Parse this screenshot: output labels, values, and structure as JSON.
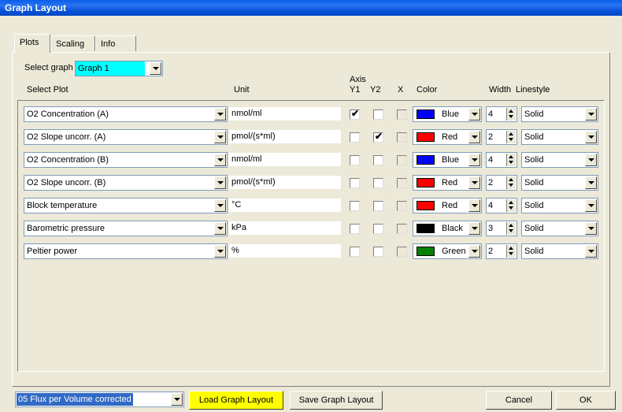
{
  "window": {
    "title": "Graph Layout"
  },
  "tabs": [
    {
      "label": "Plots"
    },
    {
      "label": "Scaling"
    },
    {
      "label": "Info"
    }
  ],
  "select_graph": {
    "label": "Select graph",
    "value": "Graph 1",
    "highlight": "#00ffff"
  },
  "headers": {
    "select_plot": "Select Plot",
    "unit": "Unit",
    "axis": "Axis",
    "y1": "Y1",
    "y2": "Y2",
    "x": "X",
    "color": "Color",
    "width": "Width",
    "linestyle": "Linestyle"
  },
  "rows": [
    {
      "plot": "O2 Concentration (A)",
      "unit": "nmol/ml",
      "y1": true,
      "y2": false,
      "x": false,
      "color_name": "Blue",
      "color_hex": "#0000ff",
      "width": "4",
      "linestyle": "Solid"
    },
    {
      "plot": "O2 Slope uncorr. (A)",
      "unit": "pmol/(s*ml)",
      "y1": false,
      "y2": true,
      "x": false,
      "color_name": "Red",
      "color_hex": "#ff0000",
      "width": "2",
      "linestyle": "Solid"
    },
    {
      "plot": "O2 Concentration (B)",
      "unit": "nmol/ml",
      "y1": false,
      "y2": false,
      "x": false,
      "color_name": "Blue",
      "color_hex": "#0000ff",
      "width": "4",
      "linestyle": "Solid"
    },
    {
      "plot": "O2 Slope uncorr. (B)",
      "unit": "pmol/(s*ml)",
      "y1": false,
      "y2": false,
      "x": false,
      "color_name": "Red",
      "color_hex": "#ff0000",
      "width": "2",
      "linestyle": "Solid"
    },
    {
      "plot": "Block temperature",
      "unit": "°C",
      "y1": false,
      "y2": false,
      "x": false,
      "color_name": "Red",
      "color_hex": "#ff0000",
      "width": "4",
      "linestyle": "Solid"
    },
    {
      "plot": "Barometric pressure",
      "unit": "kPa",
      "y1": false,
      "y2": false,
      "x": false,
      "color_name": "Black",
      "color_hex": "#000000",
      "width": "3",
      "linestyle": "Solid"
    },
    {
      "plot": "Peltier power",
      "unit": "%",
      "y1": false,
      "y2": false,
      "x": false,
      "color_name": "Green",
      "color_hex": "#008000",
      "width": "2",
      "linestyle": "Solid"
    }
  ],
  "footer": {
    "layout_select": {
      "value": "05 Flux per Volume corrected",
      "selected_bg": "#316ac5"
    },
    "load_label": "Load Graph Layout",
    "load_bg": "#ffff00",
    "save_label": "Save Graph Layout",
    "cancel_label": "Cancel",
    "ok_label": "OK"
  }
}
